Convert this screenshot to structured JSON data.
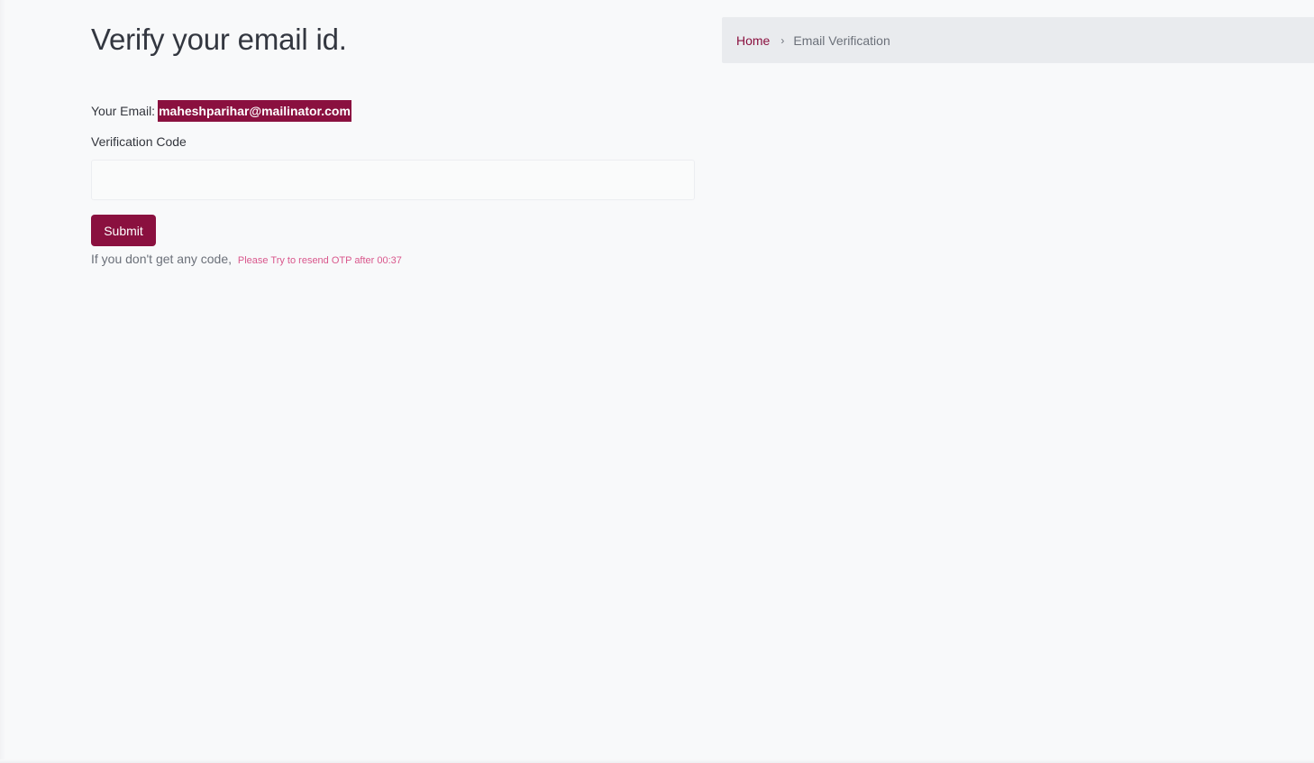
{
  "page": {
    "title": "Verify your email id."
  },
  "breadcrumb": {
    "home": "Home",
    "separator": "›",
    "current": "Email Verification"
  },
  "email": {
    "label": "Your Email:",
    "value": "maheshparihar@mailinator.com"
  },
  "form": {
    "code_label": "Verification Code",
    "code_value": "",
    "code_placeholder": "",
    "submit_label": "Submit"
  },
  "resend": {
    "prompt": "If you don't get any code,",
    "note": "Please Try to resend OTP after 00:37"
  },
  "colors": {
    "accent": "#8a103f",
    "note": "#d9578c",
    "background": "#f8f9fa",
    "breadcrumb_bg": "#e9ebee"
  },
  "icons": {
    "breadcrumb_separator": "chevron-right-icon"
  }
}
